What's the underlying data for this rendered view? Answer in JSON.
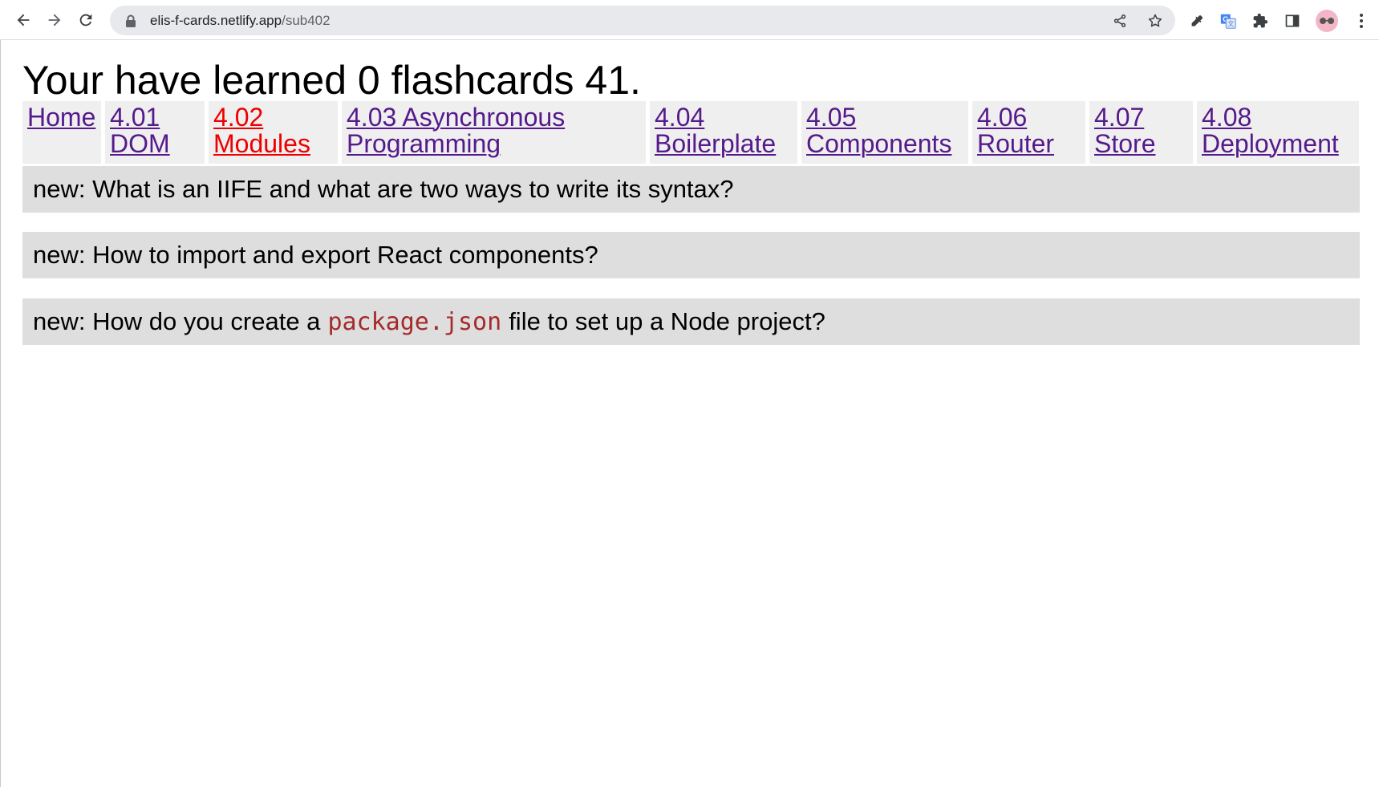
{
  "browser": {
    "url_host": "elis-f-cards.netlify.app",
    "url_path": "/sub402"
  },
  "page": {
    "title": "Your have learned 0 flashcards 41."
  },
  "nav": {
    "items": [
      {
        "line1": "Home",
        "line2": ""
      },
      {
        "line1": "4.01",
        "line2": "DOM"
      },
      {
        "line1": "4.02",
        "line2": "Modules"
      },
      {
        "line1": "4.03 Asynchronous",
        "line2": "Programming"
      },
      {
        "line1": "4.04",
        "line2": "Boilerplate"
      },
      {
        "line1": "4.05",
        "line2": "Components"
      },
      {
        "line1": "4.06",
        "line2": "Router"
      },
      {
        "line1": "4.07",
        "line2": "Store"
      },
      {
        "line1": "4.08",
        "line2": "Deployment"
      }
    ],
    "active_index": 2,
    "link_color": "#551a8b",
    "active_color": "#ee0000"
  },
  "cards": [
    {
      "prefix": "new: What is an IIFE and what are two ways to write its syntax?",
      "code": "",
      "suffix": ""
    },
    {
      "prefix": "new: How to import and export React components?",
      "code": "",
      "suffix": ""
    },
    {
      "prefix": "new: How do you create a",
      "code": "package.json",
      "suffix": "file to set up a Node project?"
    }
  ]
}
